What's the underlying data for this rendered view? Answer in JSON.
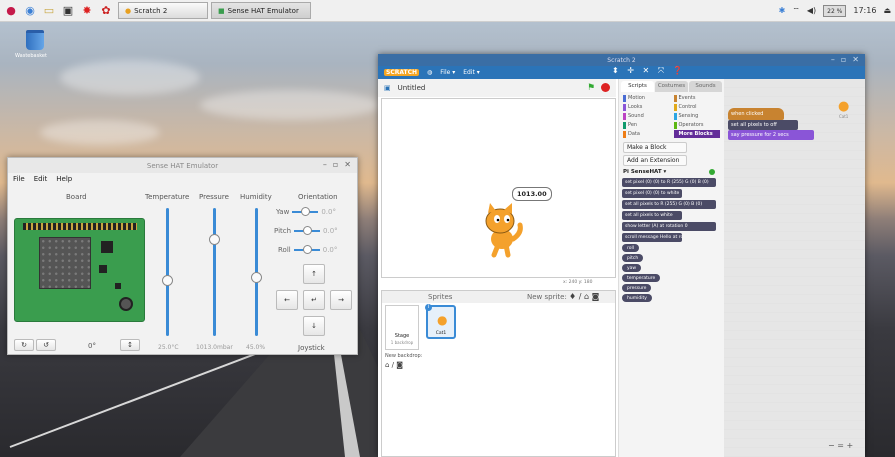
{
  "taskbar": {
    "apps": [
      {
        "label": "Scratch 2"
      },
      {
        "label": "Sense HAT Emulator"
      }
    ],
    "cpu": "22 %",
    "clock": "17:16"
  },
  "desktop": {
    "trash_label": "Wastebasket"
  },
  "sense": {
    "title": "Sense HAT Emulator",
    "menu": [
      "File",
      "Edit",
      "Help"
    ],
    "board_label": "Board",
    "sliders": [
      {
        "label": "Temperature",
        "value": "25.0°C",
        "level": 0.35
      },
      {
        "label": "Pressure",
        "value": "1013.0mbar",
        "level": 0.62
      },
      {
        "label": "Humidity",
        "value": "45.0%",
        "level": 0.45
      }
    ],
    "orientation_label": "Orientation",
    "orient": [
      {
        "label": "Yaw",
        "value": "0.0°"
      },
      {
        "label": "Pitch",
        "value": "0.0°"
      },
      {
        "label": "Roll",
        "value": "0.0°"
      }
    ],
    "joystick": {
      "up": "↑",
      "left": "←",
      "center": "↵",
      "right": "→",
      "down": "↓",
      "label": "Joystick"
    },
    "bottom": {
      "rotate_left": "↻",
      "rotate_right": "↺",
      "angle": "0°",
      "flip": "↕"
    }
  },
  "scratch": {
    "title": "Scratch 2",
    "menu": [
      "File ▾",
      "Edit ▾"
    ],
    "logo": "SCRATCH",
    "tools": "⬍ ✛ ✕ ⤧ ❓",
    "stage_title": "Untitled",
    "bubble": "1013.00",
    "coords": "x: 240  y: 180",
    "sprites_label": "Sprites",
    "new_sprite_label": "New sprite:",
    "stage_item": {
      "label": "Stage",
      "sub": "1 backdrop"
    },
    "sprite_item": "Cat1",
    "new_backdrop_label": "New backdrop:",
    "tabs": [
      "Scripts",
      "Costumes",
      "Sounds"
    ],
    "categories": [
      {
        "name": "Motion",
        "color": "#4a6cd4"
      },
      {
        "name": "Events",
        "color": "#c88330"
      },
      {
        "name": "Looks",
        "color": "#8a55d7"
      },
      {
        "name": "Control",
        "color": "#e1a91a"
      },
      {
        "name": "Sound",
        "color": "#bb42c3"
      },
      {
        "name": "Sensing",
        "color": "#2ca5e2"
      },
      {
        "name": "Pen",
        "color": "#0e9a6c"
      },
      {
        "name": "Operators",
        "color": "#5cb712"
      },
      {
        "name": "Data",
        "color": "#ee7d16"
      },
      {
        "name": "More Blocks",
        "color": "#632d99"
      }
    ],
    "make_block": "Make a Block",
    "add_ext": "Add an Extension",
    "ext_name": "Pi SenseHAT ▾",
    "blocks": [
      "set pixel (0) (0) to R (255) G (0) B (0)",
      "set pixel (0) (0) to white",
      "set all pixels to R (255) G (0) B (0)",
      "set all pixels to white",
      "show letter (A) at rotation 0",
      "scroll message Hello at rotation 0"
    ],
    "reporters": [
      "roll",
      "pitch",
      "yaw",
      "temperature",
      "pressure",
      "humidity"
    ],
    "script": {
      "hat": "when clicked",
      "b1": "set all pixels to off",
      "b2": "say pressure for 2 secs"
    },
    "sprite_info": "Cat1",
    "zoom": "− = +"
  }
}
